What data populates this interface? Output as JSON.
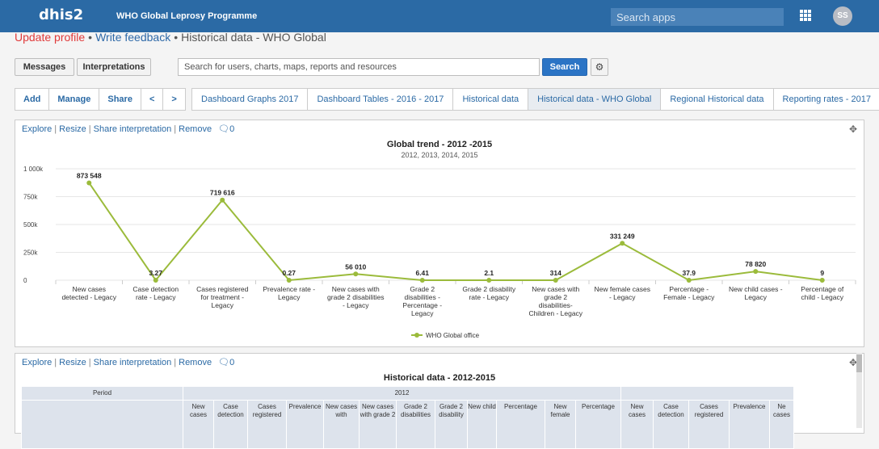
{
  "header": {
    "logo": "dhis2",
    "app_title": "WHO Global Leprosy Programme",
    "search_apps_placeholder": "Search apps",
    "avatar_initials": "SS"
  },
  "breadcrumb": {
    "update_profile": "Update profile",
    "write_feedback": "Write feedback",
    "current": "Historical data - WHO Global",
    "separator": "•"
  },
  "actions": {
    "messages": "Messages",
    "interpretations": "Interpretations",
    "search_placeholder": "Search for users, charts, maps, reports and resources",
    "search_button": "Search"
  },
  "toolbar": {
    "items": [
      "Add",
      "Manage",
      "Share",
      "<",
      ">"
    ]
  },
  "tabs": [
    {
      "label": "Dashboard Graphs 2017",
      "active": false
    },
    {
      "label": "Dashboard Tables - 2016 - 2017",
      "active": false
    },
    {
      "label": "Historical data",
      "active": false
    },
    {
      "label": "Historical data - WHO Global",
      "active": true
    },
    {
      "label": "Regional Historical data",
      "active": false
    },
    {
      "label": "Reporting rates - 2017",
      "active": false
    }
  ],
  "panel_links": {
    "explore": "Explore",
    "resize": "Resize",
    "share_interpretation": "Share interpretation",
    "remove": "Remove",
    "comment_count": "0"
  },
  "chart_data": {
    "type": "line",
    "title": "Global trend - 2012 -2015",
    "subtitle": "2012, 2013, 2014, 2015",
    "categories": [
      "New cases detected - Legacy",
      "Case detection rate - Legacy",
      "Cases registered for treatment - Legacy",
      "Prevalence rate - Legacy",
      "New cases with grade 2 disabilities - Legacy",
      "Grade 2 disabilities - Percentage - Legacy",
      "Grade 2 disability rate - Legacy",
      "New cases with grade 2 disabilities- Children - Legacy",
      "New female cases - Legacy",
      "Percentage - Female - Legacy",
      "New child cases - Legacy",
      "Percentage of child - Legacy"
    ],
    "category_lines": [
      [
        "New cases",
        "detected - Legacy"
      ],
      [
        "Case detection",
        "rate - Legacy"
      ],
      [
        "Cases registered",
        "for treatment -",
        "Legacy"
      ],
      [
        "Prevalence rate -",
        "Legacy"
      ],
      [
        "New cases with",
        "grade 2 disabilities",
        "- Legacy"
      ],
      [
        "Grade 2",
        "disabilities -",
        "Percentage -",
        "Legacy"
      ],
      [
        "Grade 2 disability",
        "rate - Legacy"
      ],
      [
        "New cases with",
        "grade 2",
        "disabilities-",
        "Children - Legacy"
      ],
      [
        "New female cases",
        "- Legacy"
      ],
      [
        "Percentage -",
        "Female - Legacy"
      ],
      [
        "New child cases -",
        "Legacy"
      ],
      [
        "Percentage of",
        "child - Legacy"
      ]
    ],
    "series": [
      {
        "name": "WHO Global office",
        "values": [
          873548,
          3.27,
          719616,
          0.27,
          56010,
          6.41,
          2.1,
          314,
          331249,
          37.9,
          78820,
          9
        ],
        "labels": [
          "873 548",
          "3.27",
          "719 616",
          "0.27",
          "56 010",
          "6.41",
          "2.1",
          "314",
          "331 249",
          "37.9",
          "78 820",
          "9"
        ]
      }
    ],
    "y_ticks": [
      0,
      250000,
      500000,
      750000,
      1000000
    ],
    "y_tick_labels": [
      "0",
      "250k",
      "500k",
      "750k",
      "1 000k"
    ],
    "ylim": [
      0,
      1000000
    ],
    "grid": true,
    "legend": "bottom-center",
    "color": "#9bbb3b"
  },
  "table": {
    "title": "Historical data - 2012-2015",
    "period_label": "Period",
    "years": [
      "2012"
    ],
    "columns": [
      "New cases",
      "Case detection",
      "Cases registered",
      "Prevalence",
      "New cases with",
      "New cases with grade 2",
      "Grade 2 disabilities",
      "Grade 2 disability",
      "New child",
      "Percentage",
      "New female",
      "Percentage",
      "New cases",
      "Case detection",
      "Cases registered",
      "Prevalence",
      "Ne cases"
    ]
  }
}
